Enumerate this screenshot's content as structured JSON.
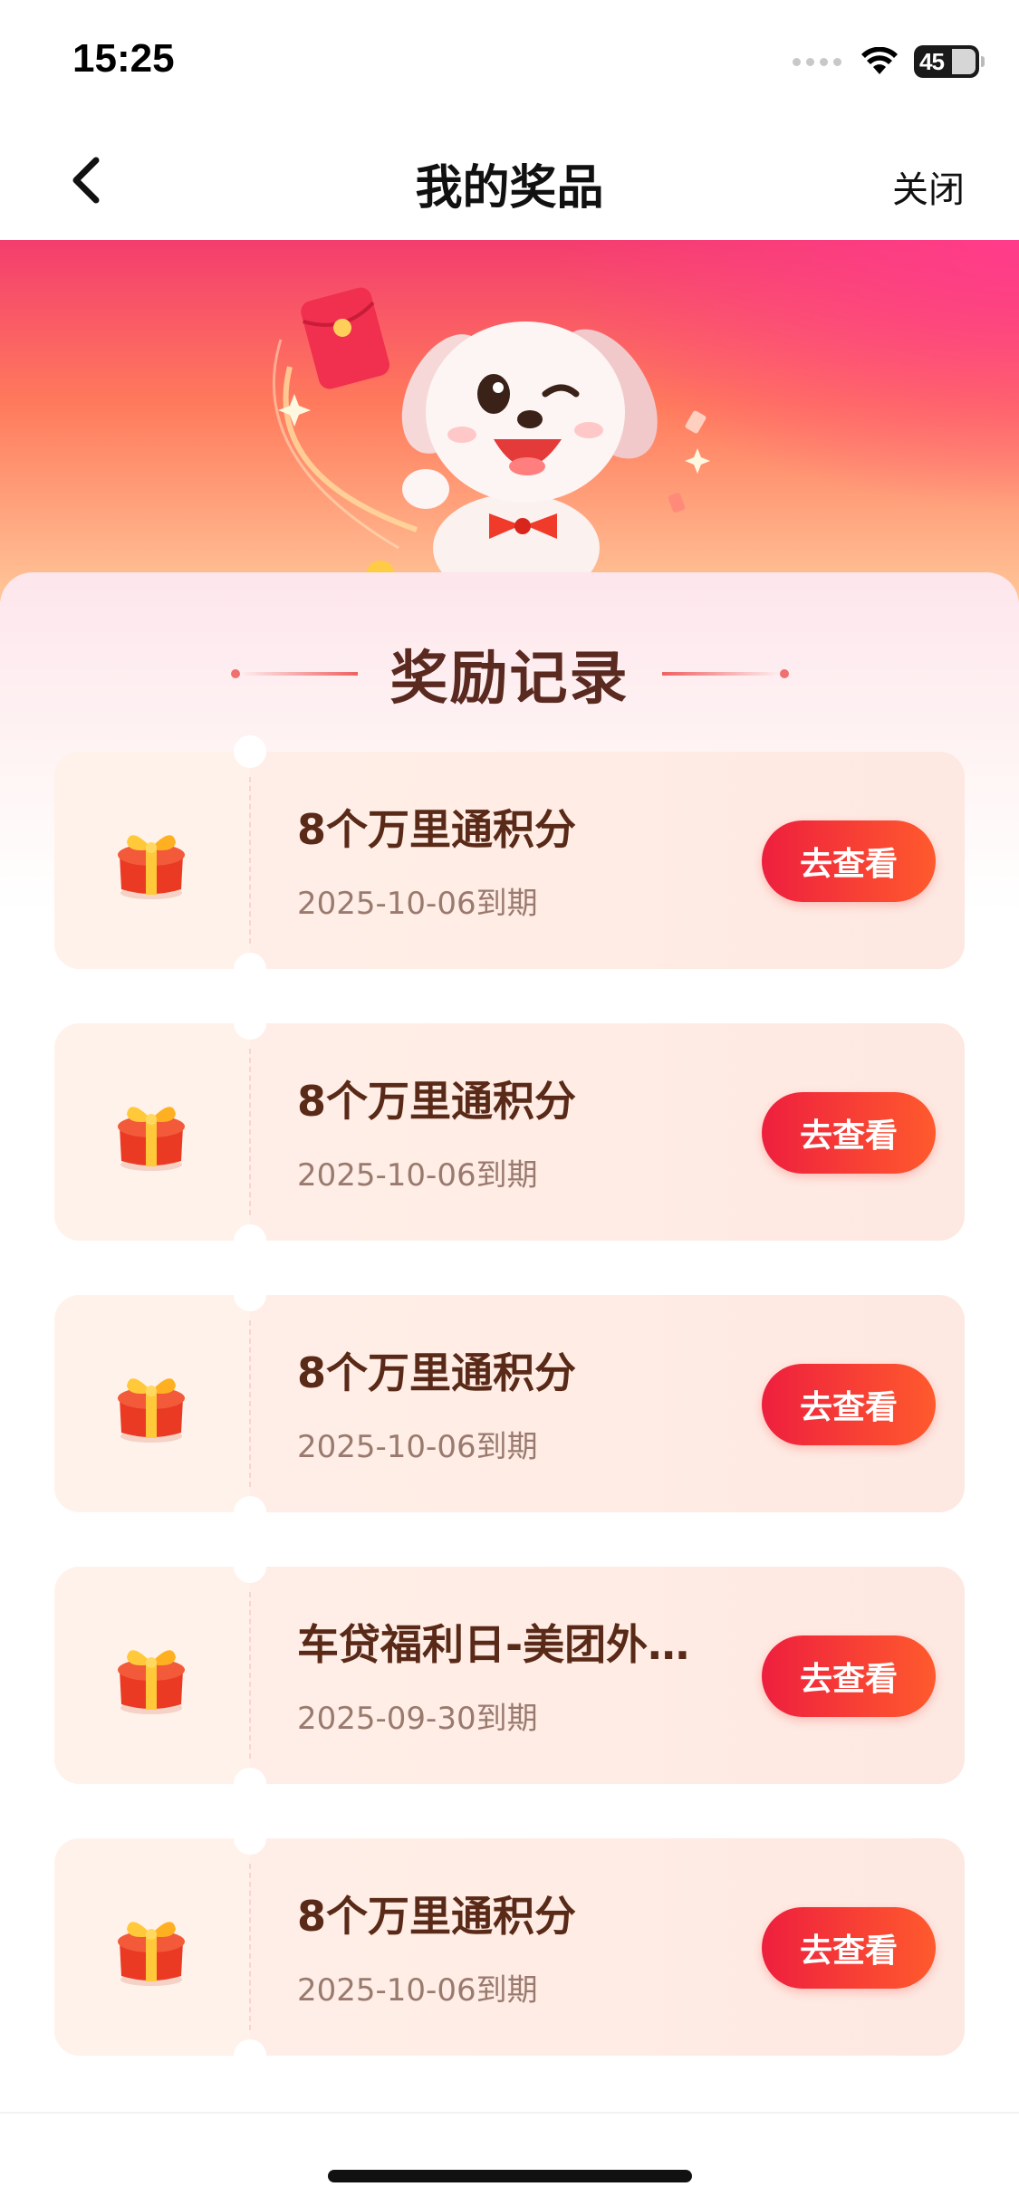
{
  "status_bar": {
    "time": "15:25",
    "battery": "45"
  },
  "nav": {
    "title": "我的奖品",
    "close_label": "关闭"
  },
  "section": {
    "title": "奖励记录"
  },
  "rewards": [
    {
      "title": "8个万里通积分",
      "expiry": "2025-10-06到期",
      "action": "去查看"
    },
    {
      "title": "8个万里通积分",
      "expiry": "2025-10-06到期",
      "action": "去查看"
    },
    {
      "title": "8个万里通积分",
      "expiry": "2025-10-06到期",
      "action": "去查看"
    },
    {
      "title": "车贷福利日-美团外…",
      "expiry": "2025-09-30到期",
      "action": "去查看"
    },
    {
      "title": "8个万里通积分",
      "expiry": "2025-10-06到期",
      "action": "去查看"
    }
  ],
  "colors": {
    "accent": "#ee1f3e",
    "banner_top": "#f43d6e",
    "card_bg": "#fff0ea",
    "title_text": "#5a2a18"
  }
}
